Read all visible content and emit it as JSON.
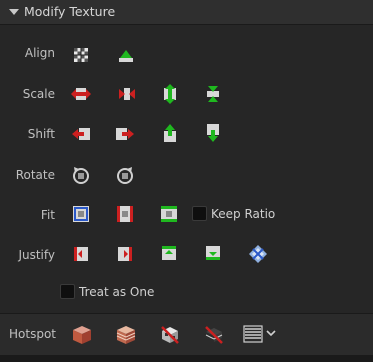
{
  "header": {
    "title": "Modify Texture"
  },
  "rows": {
    "align": {
      "label": "Align",
      "icons": [
        "align-checker-icon",
        "align-warp-icon"
      ]
    },
    "scale": {
      "label": "Scale",
      "icons": [
        "scale-horizontal-expand-icon",
        "scale-horizontal-shrink-icon",
        "scale-vertical-expand-icon",
        "scale-vertical-shrink-icon"
      ]
    },
    "shift": {
      "label": "Shift",
      "icons": [
        "shift-left-icon",
        "shift-right-icon",
        "shift-up-icon",
        "shift-down-icon"
      ]
    },
    "rotate": {
      "label": "Rotate",
      "icons": [
        "rotate-counterclockwise-icon",
        "rotate-clockwise-icon"
      ]
    },
    "fit": {
      "label": "Fit",
      "icons": [
        "fit-both-icon",
        "fit-horizontal-icon",
        "fit-vertical-icon"
      ],
      "keep_ratio_label": "Keep Ratio"
    },
    "justify": {
      "label": "Justify",
      "icons": [
        "justify-left-icon",
        "justify-right-icon",
        "justify-top-icon",
        "justify-bottom-icon",
        "justify-center-icon"
      ]
    },
    "treat_as_one": {
      "label": "Treat as One"
    }
  },
  "hotspot": {
    "label": "Hotspot",
    "icons": [
      "hotspot-cube-icon",
      "hotspot-bricks-icon",
      "hotspot-disable-icon",
      "hotspot-disable-bricks-icon",
      "hotspot-menu-icon",
      "chevron-down-icon"
    ]
  },
  "colors": {
    "red": "#cc2020",
    "green": "#1fb81f",
    "panel_bg": "#262626",
    "header_bg": "#2f2f2f"
  }
}
